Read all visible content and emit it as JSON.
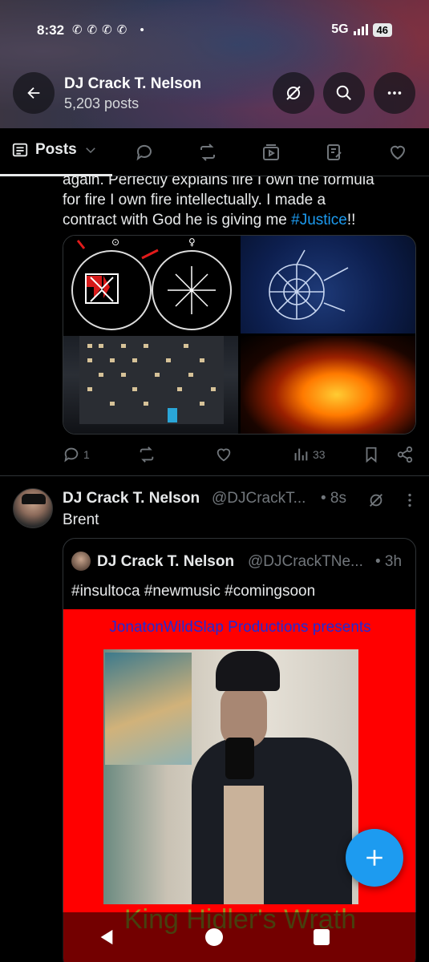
{
  "status_bar": {
    "time": "8:32",
    "network": "5G",
    "battery": "46"
  },
  "profile_header": {
    "name": "DJ Crack T. Nelson",
    "posts_count": "5,203 posts"
  },
  "tabs": {
    "active": "Posts"
  },
  "post1": {
    "text_lines": [
      "again. Perfectly explains fire I own the formula",
      "for fire I own fire intellectually. I made a"
    ],
    "text_line3_prefix": "contract with God he is giving me ",
    "hashtag": "#Justice",
    "text_line3_suffix": "!!",
    "replies": "1",
    "views": "33"
  },
  "post2": {
    "name": "DJ Crack T. Nelson",
    "handle": "@DJCrackT...",
    "time": "• 8s",
    "text": "Brent",
    "quote": {
      "name": "DJ Crack T. Nelson",
      "handle": "@DJCrackTNe...",
      "time": "• 3h",
      "text": "#insultoca #newmusic #comingsoon",
      "poster_top": "JonatonWildSlap Productions presents",
      "poster_title": "King Hidler's Wrath"
    }
  },
  "colors": {
    "accent": "#1d9bf0",
    "background": "#000000",
    "poster_red": "#ff0000"
  },
  "icons": [
    "back-arrow-icon",
    "no-grok-icon",
    "search-icon",
    "more-icon",
    "posts-icon",
    "chevron-down-icon",
    "reply-icon",
    "repost-icon",
    "media-icon",
    "articles-icon",
    "like-icon",
    "views-icon",
    "bookmark-icon",
    "share-icon",
    "plus-icon"
  ]
}
